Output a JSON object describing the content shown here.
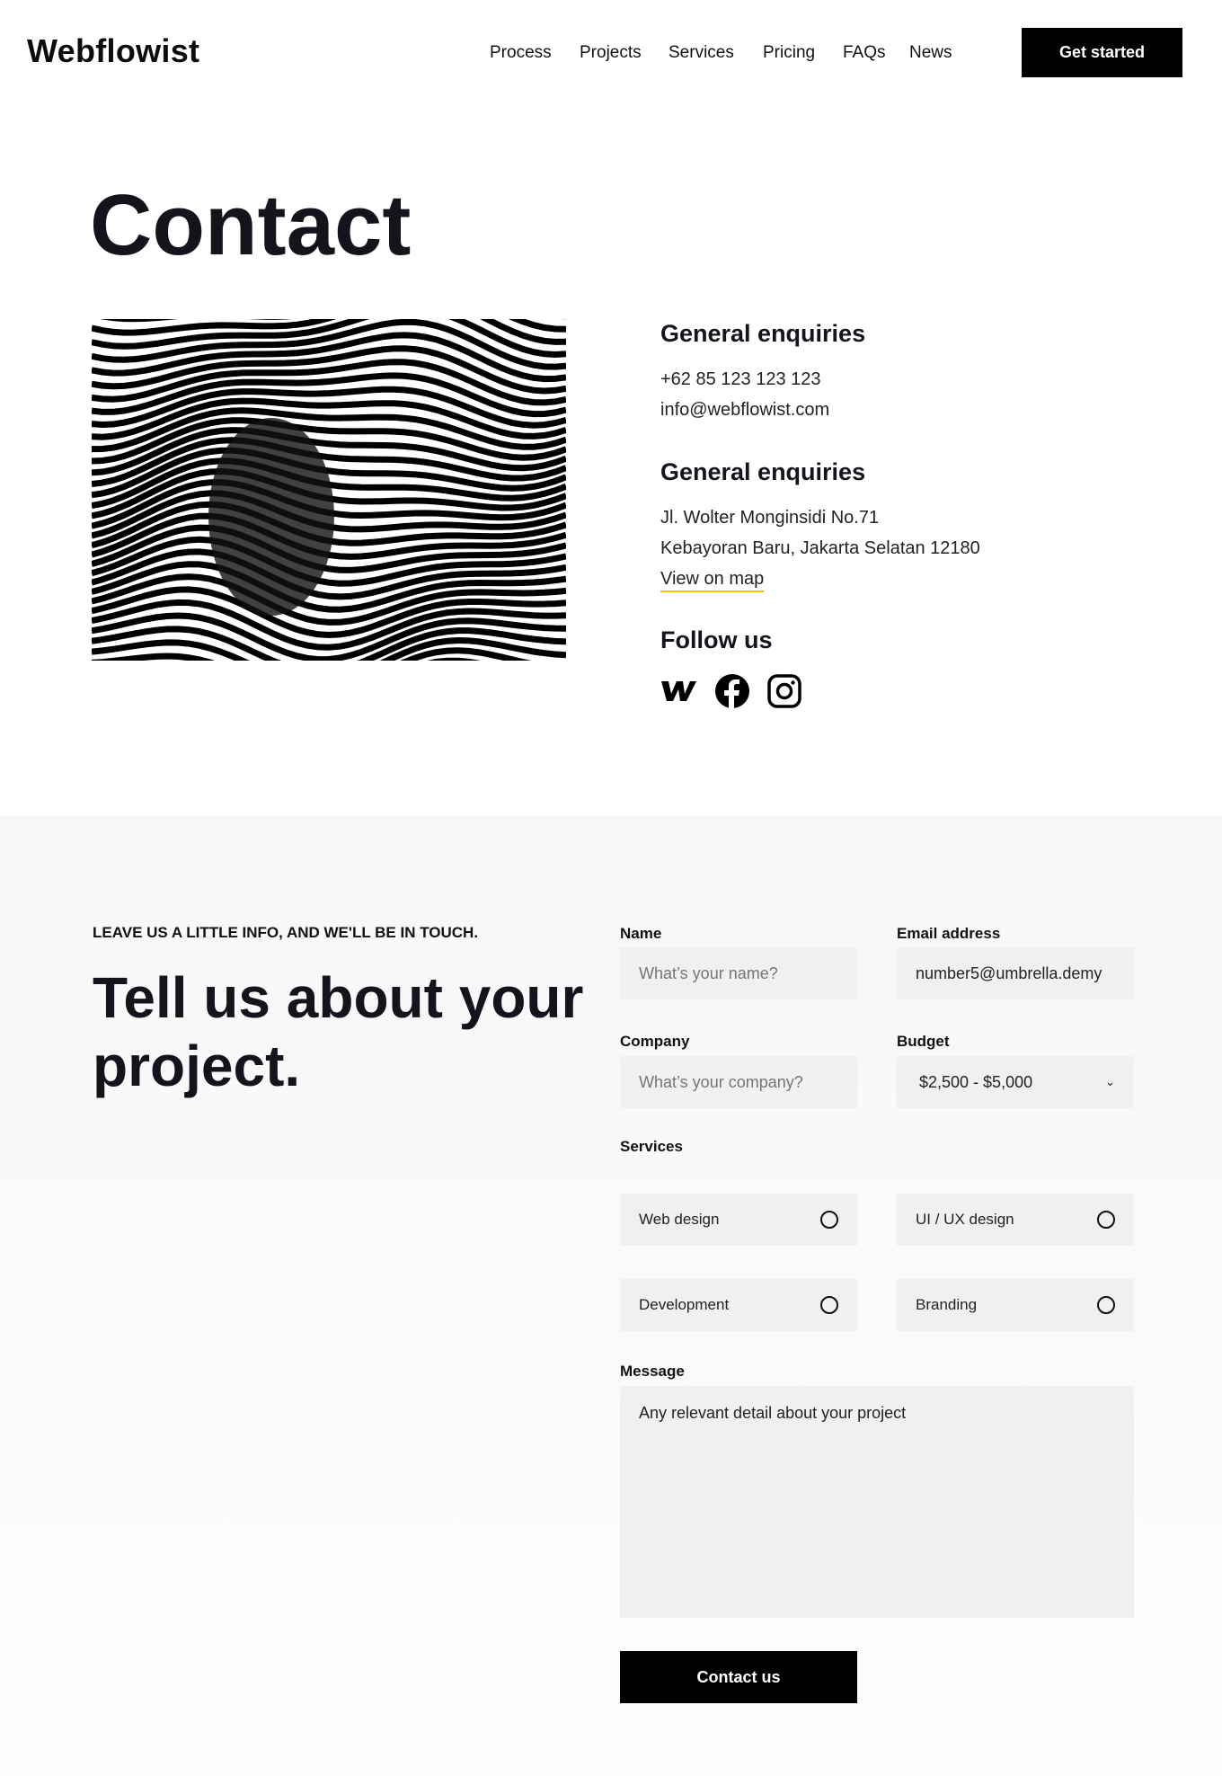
{
  "header": {
    "logo": "Webflowist",
    "nav": [
      "Process",
      "Projects",
      "Services",
      "Pricing",
      "FAQs",
      "News"
    ],
    "cta": "Get started"
  },
  "hero": {
    "title": "Contact"
  },
  "contact": {
    "general_heading": "General enquiries",
    "phone": "+62 85 123 123 123",
    "email": "info@webflowist.com",
    "address_heading": "General enquiries",
    "address_line1": "Jl. Wolter Monginsidi No.71",
    "address_line2": "Kebayoran Baru, Jakarta Selatan 12180",
    "map_link": "View on map",
    "follow_heading": "Follow us",
    "socials": [
      "webflow-icon",
      "facebook-icon",
      "instagram-icon"
    ],
    "accent": "#f2c200"
  },
  "form": {
    "eyebrow": "LEAVE US A LITTLE INFO, AND WE'LL BE IN TOUCH.",
    "heading": "Tell us about your project.",
    "name_label": "Name",
    "name_placeholder": "What’s your name?",
    "email_label": "Email address",
    "email_value": "number5@umbrella.demy",
    "company_label": "Company",
    "company_placeholder": "What’s your company?",
    "budget_label": "Budget",
    "budget_value": "$2,500 - $5,000",
    "services_label": "Services",
    "services": [
      "Web design",
      "UI / UX design",
      "Development",
      "Branding"
    ],
    "message_label": "Message",
    "message_placeholder": "Any relevant detail about your project",
    "submit": "Contact us"
  }
}
